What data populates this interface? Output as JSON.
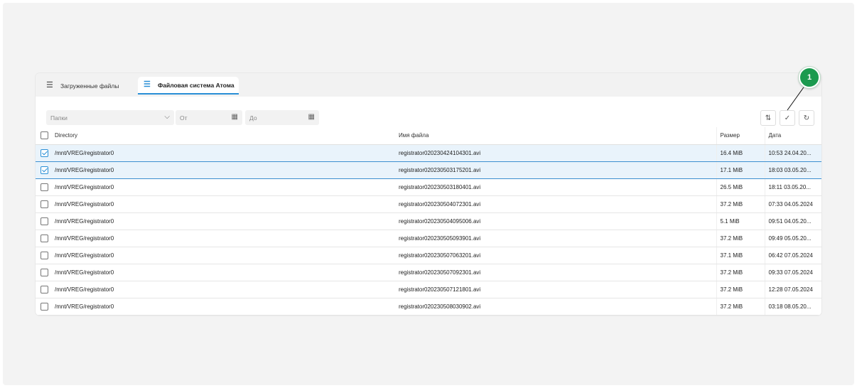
{
  "tabs": [
    {
      "label": "Загруженные файлы",
      "icon": "list-icon"
    },
    {
      "label": "Файловая система Атома",
      "icon": "menu-icon"
    }
  ],
  "filters": {
    "folders_placeholder": "Папки",
    "from_placeholder": "От",
    "to_placeholder": "До"
  },
  "toolbar": {
    "icons": [
      "transfer-icon",
      "double-check-icon",
      "refresh-icon"
    ]
  },
  "annotation": {
    "label": "1"
  },
  "table": {
    "headers": {
      "directory": "Directory",
      "name": "Имя файла",
      "size": "Размер",
      "date": "Дата"
    },
    "rows": [
      {
        "checked": true,
        "dir": "/mnt/VREG/registrator0",
        "name": "registrator020230424104301.avi",
        "size": "16.4 MiB",
        "date": "10:53 24.04.20..."
      },
      {
        "checked": true,
        "dir": "/mnt/VREG/registrator0",
        "name": "registrator020230503175201.avi",
        "size": "17.1 MiB",
        "date": "18:03 03.05.20..."
      },
      {
        "checked": false,
        "dir": "/mnt/VREG/registrator0",
        "name": "registrator020230503180401.avi",
        "size": "26.5 MiB",
        "date": "18:11 03.05.20..."
      },
      {
        "checked": false,
        "dir": "/mnt/VREG/registrator0",
        "name": "registrator020230504072301.avi",
        "size": "37.2 MiB",
        "date": "07:33 04.05.2024"
      },
      {
        "checked": false,
        "dir": "/mnt/VREG/registrator0",
        "name": "registrator020230504095006.avi",
        "size": "5.1 MiB",
        "date": "09:51 04.05.20..."
      },
      {
        "checked": false,
        "dir": "/mnt/VREG/registrator0",
        "name": "registrator020230505093901.avi",
        "size": "37.2 MiB",
        "date": "09:49 05.05.20..."
      },
      {
        "checked": false,
        "dir": "/mnt/VREG/registrator0",
        "name": "registrator020230507063201.avi",
        "size": "37.1 MiB",
        "date": "06:42 07.05.2024"
      },
      {
        "checked": false,
        "dir": "/mnt/VREG/registrator0",
        "name": "registrator020230507092301.avi",
        "size": "37.2 MiB",
        "date": "09:33 07.05.2024"
      },
      {
        "checked": false,
        "dir": "/mnt/VREG/registrator0",
        "name": "registrator020230507121801.avi",
        "size": "37.2 MiB",
        "date": "12:28 07.05.2024"
      },
      {
        "checked": false,
        "dir": "/mnt/VREG/registrator0",
        "name": "registrator020230508030902.avi",
        "size": "37.2 MiB",
        "date": "03:18 08.05.20..."
      }
    ]
  }
}
